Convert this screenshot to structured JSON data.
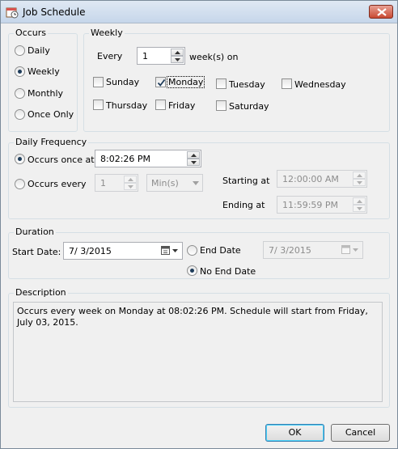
{
  "window": {
    "title": "Job Schedule",
    "close_icon": "close-icon",
    "app_icon": "calendar-clock-icon"
  },
  "occurs": {
    "legend": "Occurs",
    "options": [
      "Daily",
      "Weekly",
      "Monthly",
      "Once Only"
    ],
    "selected": "Weekly"
  },
  "weekly": {
    "legend": "Weekly",
    "every_label": "Every",
    "every_value": "1",
    "weeks_on_label": "week(s) on",
    "days": [
      {
        "label": "Sunday",
        "checked": false
      },
      {
        "label": "Monday",
        "checked": true
      },
      {
        "label": "Tuesday",
        "checked": false
      },
      {
        "label": "Wednesday",
        "checked": false
      },
      {
        "label": "Thursday",
        "checked": false
      },
      {
        "label": "Friday",
        "checked": false
      },
      {
        "label": "Saturday",
        "checked": false
      }
    ]
  },
  "daily_frequency": {
    "legend": "Daily Frequency",
    "once_label": "Occurs once at",
    "once_time": "8:02:26 PM",
    "every_label": "Occurs every",
    "every_value": "1",
    "every_unit": "Min(s)",
    "starting_label": "Starting at",
    "starting_value": "12:00:00 AM",
    "ending_label": "Ending at",
    "ending_value": "11:59:59 PM",
    "selected": "once"
  },
  "duration": {
    "legend": "Duration",
    "start_label": "Start Date:",
    "start_value": "7/  3/2015",
    "end_date_label": "End Date",
    "end_date_value": "7/  3/2015",
    "no_end_label": "No End Date",
    "selected": "no_end"
  },
  "description": {
    "legend": "Description",
    "text": "Occurs every week on Monday at 08:02:26 PM. Schedule will start from Friday, July 03, 2015."
  },
  "buttons": {
    "ok": "OK",
    "cancel": "Cancel"
  },
  "colors": {
    "radio_dot": "#1e3c5a",
    "close_button": "#c94a33",
    "default_button_border": "#3c7fb1"
  }
}
